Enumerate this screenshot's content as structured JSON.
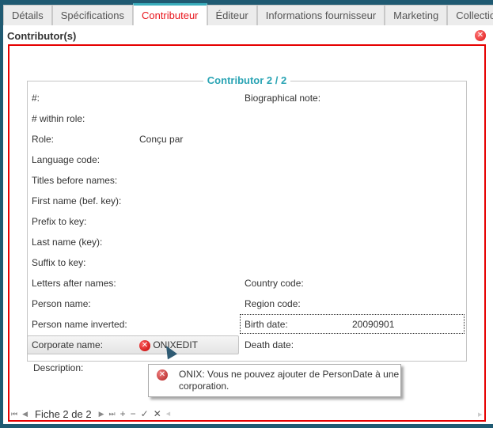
{
  "tabs": [
    {
      "label": "Détails",
      "active": false
    },
    {
      "label": "Spécifications",
      "active": false
    },
    {
      "label": "Contributeur",
      "active": true
    },
    {
      "label": "Éditeur",
      "active": false
    },
    {
      "label": "Informations fournisseur",
      "active": false
    },
    {
      "label": "Marketing",
      "active": false
    },
    {
      "label": "Collection",
      "active": false
    }
  ],
  "section": {
    "title": "Contributor(s)",
    "close_icon": "close-circle-icon"
  },
  "record": {
    "legend": "Contributor 2 / 2",
    "left_fields": [
      {
        "label": "#:",
        "value": ""
      },
      {
        "label": "# within role:",
        "value": ""
      },
      {
        "label": "Role:",
        "value": "Conçu par"
      },
      {
        "label": "Language code:",
        "value": ""
      },
      {
        "label": "Titles before names:",
        "value": ""
      },
      {
        "label": "First name (bef. key):",
        "value": ""
      },
      {
        "label": "Prefix to key:",
        "value": ""
      },
      {
        "label": "Last name (key):",
        "value": ""
      },
      {
        "label": "Suffix to key:",
        "value": ""
      },
      {
        "label": "Letters after names:",
        "value": ""
      },
      {
        "label": "Person name:",
        "value": ""
      },
      {
        "label": "Person name inverted:",
        "value": ""
      },
      {
        "label": "Corporate name:",
        "value": "ONIXEDIT"
      },
      {
        "label": "Description:",
        "value": ""
      }
    ],
    "right_fields": [
      {
        "label": "Biographical note:",
        "value": ""
      },
      {
        "label": "Country code:",
        "value": ""
      },
      {
        "label": "Region code:",
        "value": ""
      },
      {
        "label": "Birth date:",
        "value": "20090901"
      },
      {
        "label": "Death date:",
        "value": ""
      }
    ]
  },
  "tooltip": {
    "message": "ONIX: Vous ne pouvez ajouter de PersonDate à une corporation."
  },
  "pager": {
    "text": "Fiche 2 de 2",
    "first": "⏮",
    "prev": "◀",
    "next": "▶",
    "last": "⏭",
    "add": "+",
    "remove": "−",
    "confirm": "✓",
    "cancel": "✕",
    "scroll_left": "◀",
    "scroll_right": "▶"
  }
}
